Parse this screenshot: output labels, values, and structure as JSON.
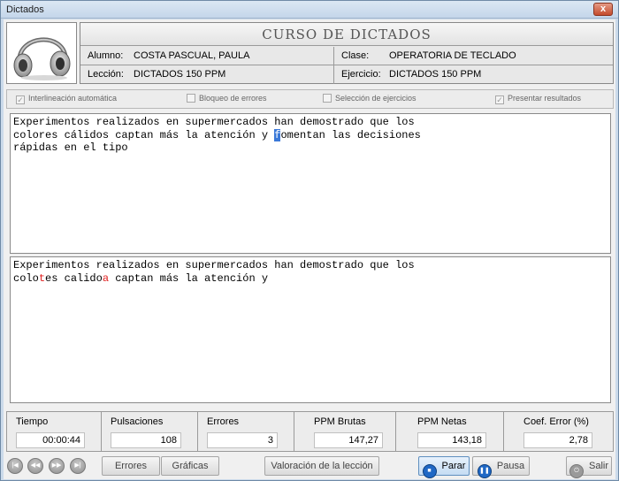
{
  "window": {
    "title": "Dictados",
    "close": "x"
  },
  "header": {
    "course_title": "CURSO DE DICTADOS",
    "alumno_label": "Alumno:",
    "alumno_value": "COSTA PASCUAL, PAULA",
    "clase_label": "Clase:",
    "clase_value": "OPERATORIA DE TECLADO",
    "leccion_label": "Lección:",
    "leccion_value": "DICTADOS 150 PPM",
    "ejercicio_label": "Ejercicio:",
    "ejercicio_value": "DICTADOS 150 PPM",
    "logo_icon": "headphones-icon"
  },
  "options": [
    {
      "label": "Interlineación automática",
      "checked": true
    },
    {
      "label": "Bloqueo de errores",
      "checked": false
    },
    {
      "label": "Selección de ejercicios",
      "checked": false
    },
    {
      "label": "Presentar resultados",
      "checked": true
    }
  ],
  "source_text": {
    "line1": "Experimentos realizados en supermercados han demostrado que los",
    "line2_before": "colores cálidos captan más la atención y ",
    "line2_cursor": "f",
    "line2_after": "omentan las decisiones",
    "line3": "rápidas en el tipo"
  },
  "typed_text": {
    "line1": "Experimentos realizados en supermercados han demostrado que los",
    "line2_a": "colo",
    "line2_err1": "t",
    "line2_b": "es calido",
    "line2_err2": "a",
    "line2_c": " captan más la atención y"
  },
  "stats": [
    {
      "label": "Tiempo",
      "value": "00:00:44"
    },
    {
      "label": "Pulsaciones",
      "value": "108"
    },
    {
      "label": "Errores",
      "value": "3"
    },
    {
      "label": "PPM Brutas",
      "value": "147,27"
    },
    {
      "label": "PPM Netas",
      "value": "143,18"
    },
    {
      "label": "Coef. Error (%)",
      "value": "2,78"
    }
  ],
  "toolbar": {
    "nav_first_icon": "skip-back-icon",
    "nav_prev_icon": "rewind-icon",
    "nav_next_icon": "fast-forward-icon",
    "nav_last_icon": "skip-forward-icon",
    "errores": "Errores",
    "graficas": "Gráficas",
    "valoracion": "Valoración de la lección",
    "parar": "Parar",
    "pausa": "Pausa",
    "salir": "Salir"
  }
}
